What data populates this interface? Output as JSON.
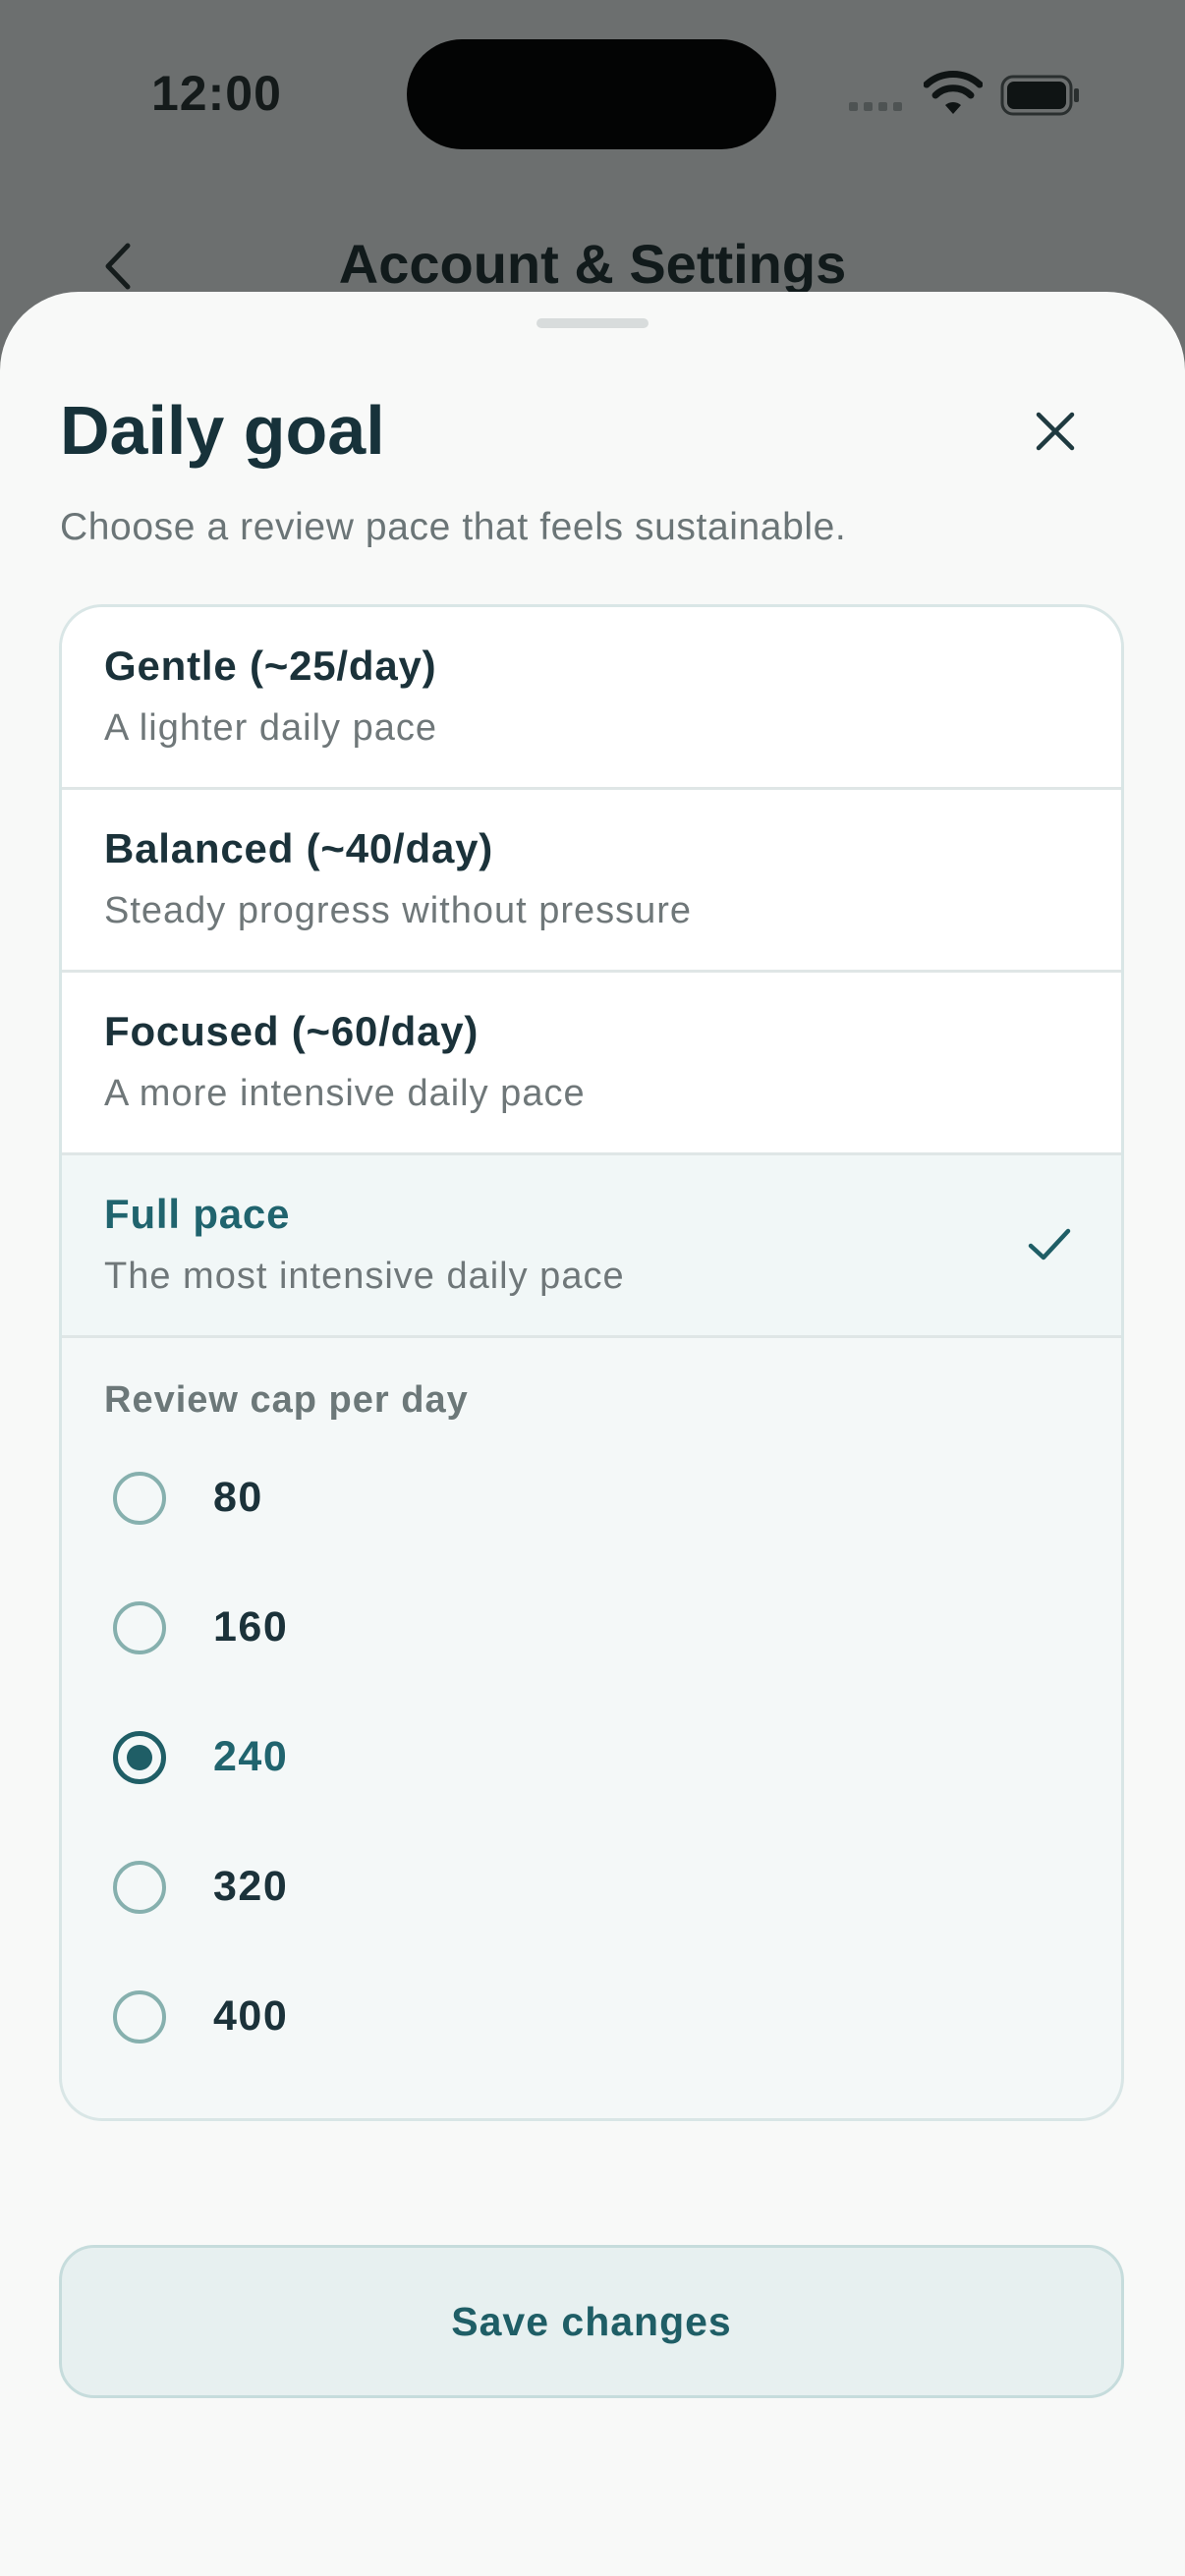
{
  "status_bar": {
    "time": "12:00"
  },
  "background_screen": {
    "title": "Account & Settings"
  },
  "sheet": {
    "title": "Daily goal",
    "subtitle": "Choose a review pace that feels sustainable.",
    "options": [
      {
        "title": "Gentle (~25/day)",
        "description": "A lighter daily pace",
        "selected": false
      },
      {
        "title": "Balanced (~40/day)",
        "description": "Steady progress without pressure",
        "selected": false
      },
      {
        "title": "Focused (~60/day)",
        "description": "A more intensive daily pace",
        "selected": false
      },
      {
        "title": "Full pace",
        "description": "The most intensive daily pace",
        "selected": true
      }
    ],
    "cap": {
      "label": "Review cap per day",
      "choices": [
        "80",
        "160",
        "240",
        "320",
        "400"
      ],
      "selected_value": "240"
    },
    "save_label": "Save changes"
  },
  "icons": {
    "back": "chevron-left-icon",
    "close": "close-icon",
    "check": "checkmark-icon",
    "wifi": "wifi-icon",
    "battery": "battery-icon"
  },
  "colors": {
    "accent": "#20646e",
    "title_text": "#17323a",
    "muted_text": "#6f7779",
    "sheet_background": "#f8f9f8",
    "scrim": "#6c6f6f"
  }
}
